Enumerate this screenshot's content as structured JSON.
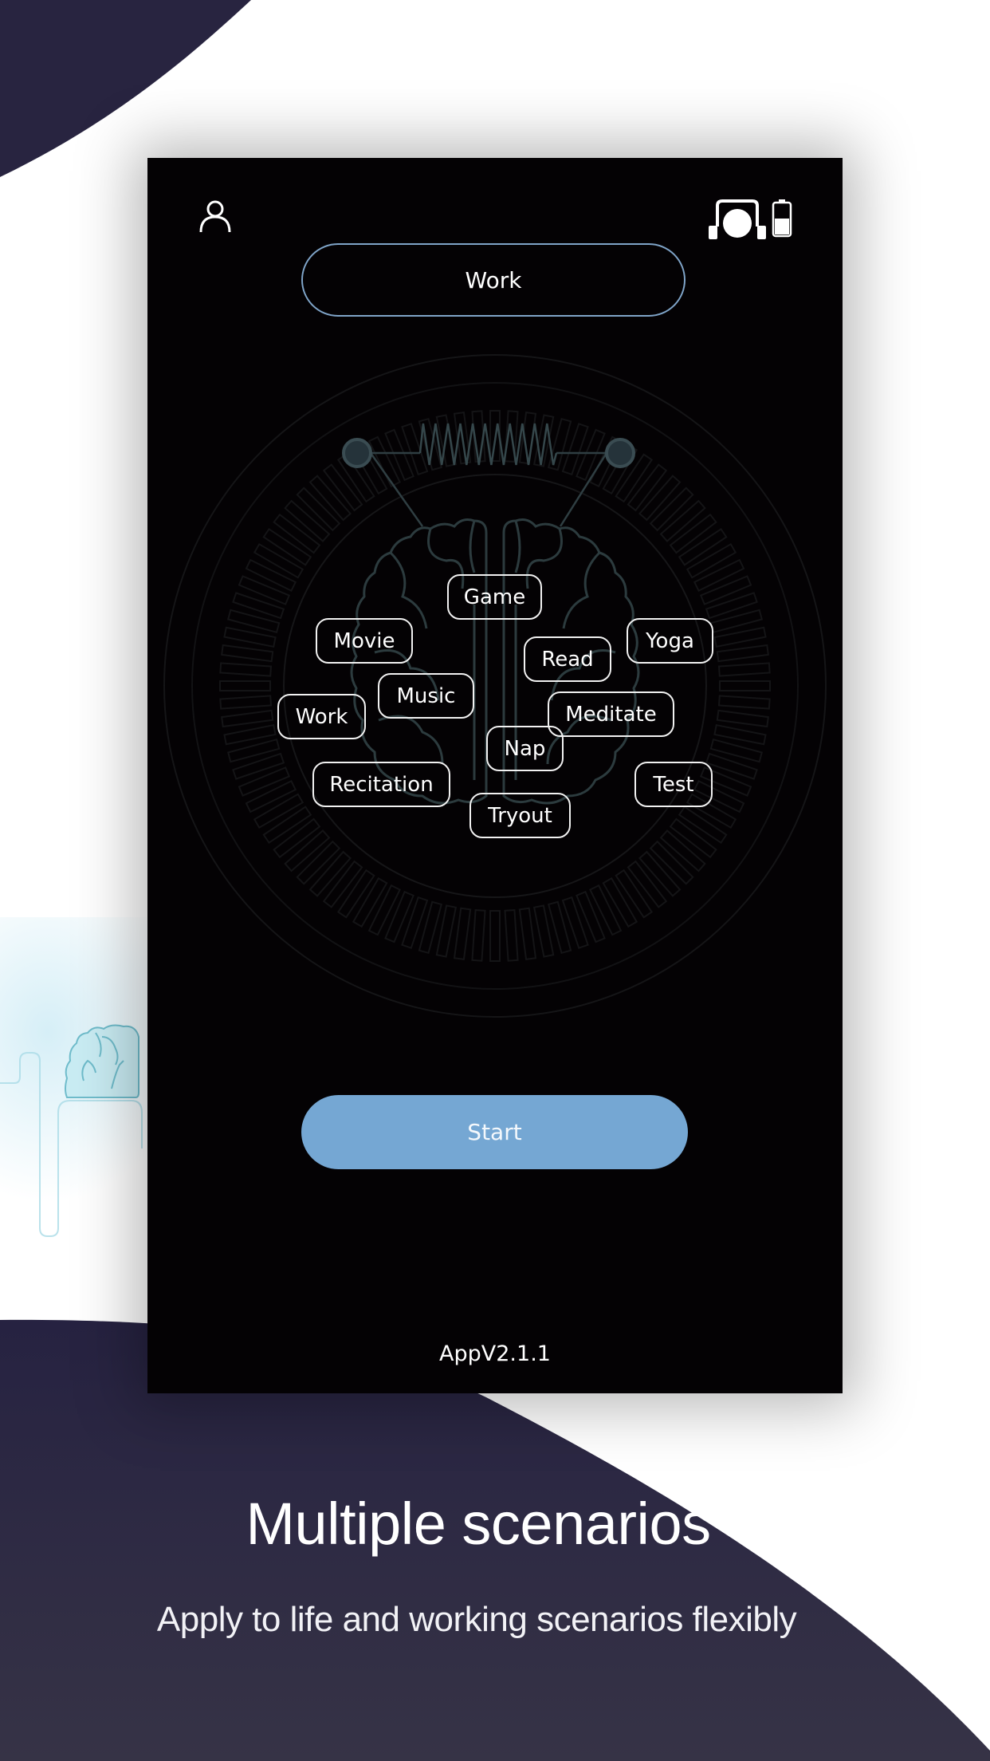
{
  "app": {
    "mode_selector": {
      "selected": "Work"
    },
    "scenarios": [
      {
        "label": "Game"
      },
      {
        "label": "Movie"
      },
      {
        "label": "Read"
      },
      {
        "label": "Yoga"
      },
      {
        "label": "Music"
      },
      {
        "label": "Work"
      },
      {
        "label": "Meditate"
      },
      {
        "label": "Nap"
      },
      {
        "label": "Recitation"
      },
      {
        "label": "Test"
      },
      {
        "label": "Tryout"
      }
    ],
    "start_label": "Start",
    "version": "AppV2.1.1",
    "icons": {
      "profile": "user-icon",
      "device": "headset-icon",
      "battery": "battery-icon"
    },
    "battery_level": 0.5
  },
  "promo": {
    "title": "Multiple scenarios",
    "subtitle": "Apply to life and working scenarios flexibly"
  },
  "colors": {
    "background_dark": "#282440",
    "phone_bg": "#040204",
    "accent": "#75a7d3",
    "pill_border": "#7fa4c8",
    "graphic_line": "#34464a"
  }
}
